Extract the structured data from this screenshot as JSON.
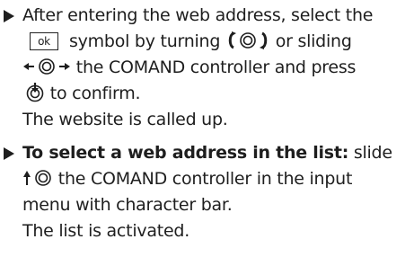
{
  "instructions": [
    {
      "line1": "After entering the web address, select the",
      "line2_ok_label": "ok",
      "line2_a": "symbol by turning",
      "line2_b": "or sliding",
      "line3_b": "the COMAND controller and press",
      "line4_b": "to confirm.",
      "result": "The website is called up."
    },
    {
      "line1_bold": "To select a web address in the list:",
      "line1_rest": "slide",
      "line2_b": "the COMAND controller in the input",
      "line3": "menu with character bar.",
      "result": "The list is activated."
    }
  ],
  "icons": {
    "bullet": "right-triangle-bullet-icon",
    "turn": "controller-turn-icon",
    "slide_lr": "controller-slide-left-right-icon",
    "press": "controller-press-icon",
    "slide_up": "controller-slide-up-icon"
  },
  "colors": {
    "text": "#1e1e1e",
    "background": "#ffffff"
  }
}
